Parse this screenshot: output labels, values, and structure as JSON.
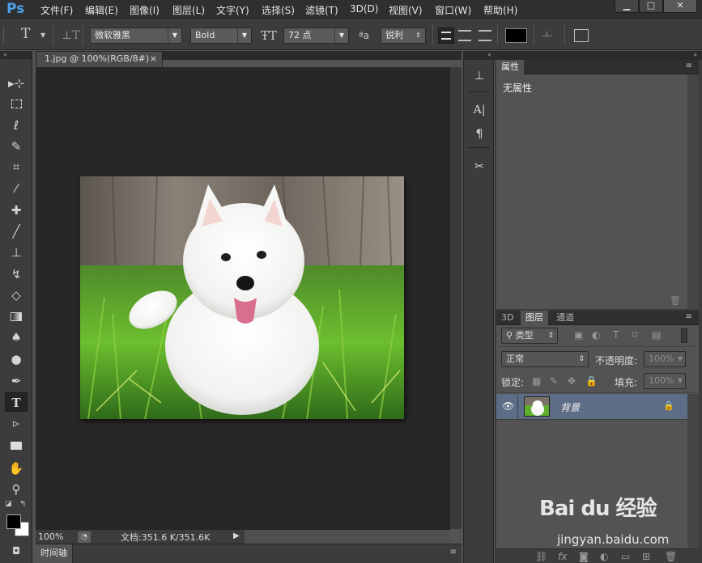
{
  "app": {
    "logo": "Ps"
  },
  "menu": [
    "文件(F)",
    "编辑(E)",
    "图像(I)",
    "图层(L)",
    "文字(Y)",
    "选择(S)",
    "滤镜(T)",
    "3D(D)",
    "视图(V)",
    "窗口(W)",
    "帮助(H)"
  ],
  "window_controls": {
    "minimize": "▁",
    "maximize": "□",
    "close": "✕"
  },
  "options": {
    "font_family": "微软雅黑",
    "font_style": "Bold",
    "font_size": "72 点",
    "aa_label": "ªa",
    "antialias": "锐利"
  },
  "document": {
    "tab_title": "1.jpg @ 100%(RGB/8#)",
    "tab_close": "×",
    "zoom": "100%",
    "doc_info": "文档:351.6 K/351.6K"
  },
  "timeline": {
    "label": "时间轴"
  },
  "properties_panel": {
    "tab": "属性",
    "content": "无属性"
  },
  "layers_panel": {
    "tabs": [
      "3D",
      "图层",
      "通道"
    ],
    "active_tab": "图层",
    "filter": "类型",
    "blend_mode": "正常",
    "opacity_label": "不透明度:",
    "opacity_value": "100%",
    "lock_label": "锁定:",
    "fill_label": "填充:",
    "fill_value": "100%",
    "layers": [
      {
        "name": "背景",
        "visible": true,
        "locked": true
      }
    ]
  },
  "colors": {
    "accent": "#4ea0e8",
    "foreground": "#000000",
    "background": "#ffffff",
    "selected_layer": "#5d6d86"
  },
  "watermark": {
    "brand": "Bai du 经验",
    "url": "jingyan.baidu.com"
  }
}
